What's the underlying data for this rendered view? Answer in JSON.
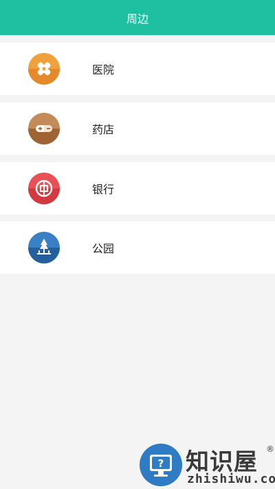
{
  "header": {
    "title": "周边"
  },
  "items": [
    {
      "label": "医院",
      "icon": "hospital-icon",
      "color": "#f0a13c"
    },
    {
      "label": "药店",
      "icon": "pill-icon",
      "color": "#b57a47"
    },
    {
      "label": "银行",
      "icon": "bank-icon",
      "color": "#e2434a"
    },
    {
      "label": "公园",
      "icon": "park-icon",
      "color": "#2d6fb2"
    }
  ],
  "watermark": {
    "cn": "知识屋",
    "reg": "®",
    "en": "zhishiwu.com"
  },
  "colors": {
    "accent": "#1fbfa2",
    "background": "#f4f4f4"
  }
}
